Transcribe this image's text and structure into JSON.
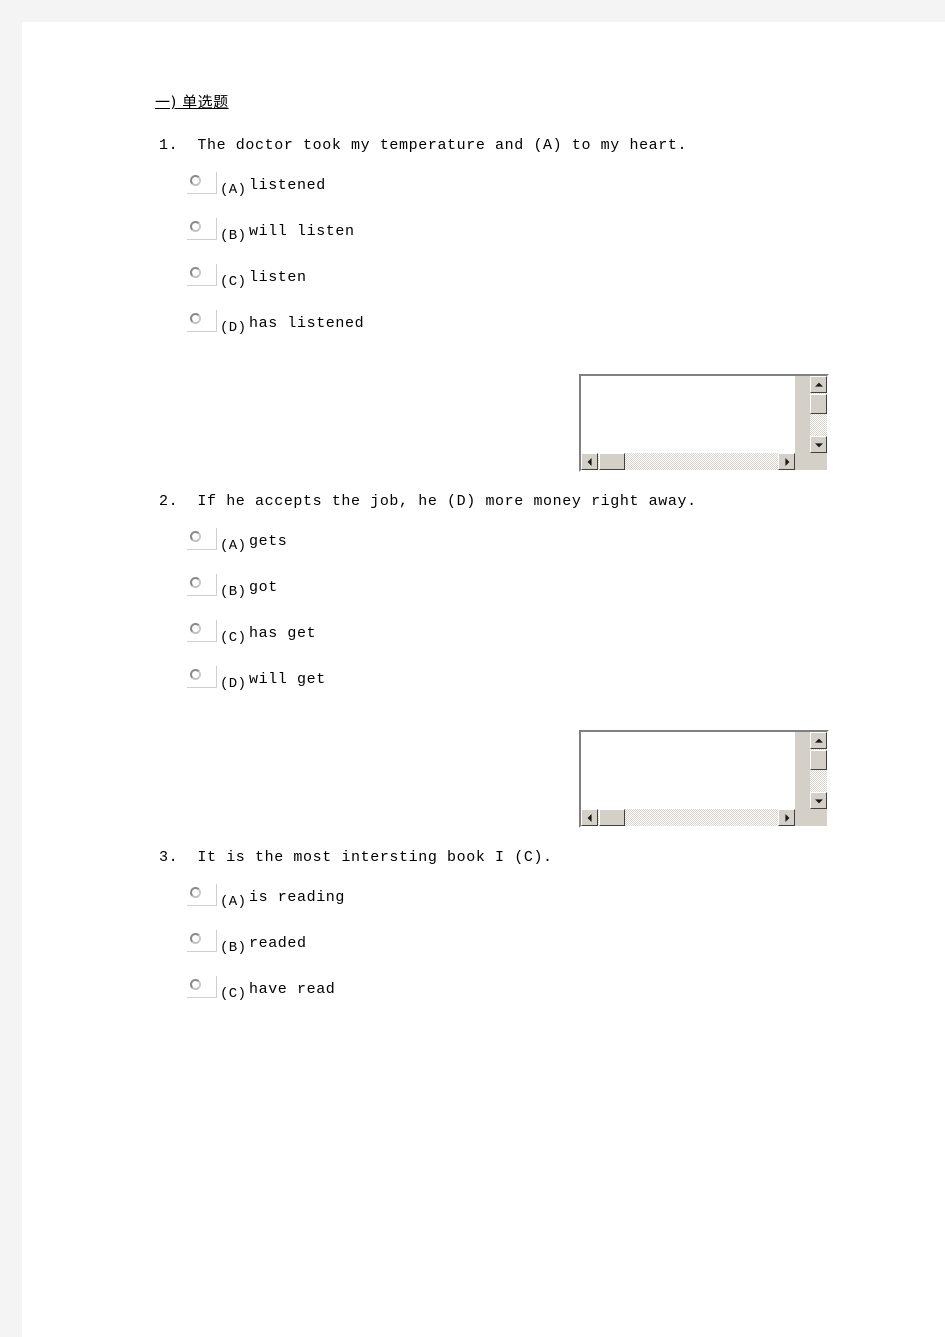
{
  "section": {
    "title": "一) 单选题"
  },
  "questions": [
    {
      "number": "1.",
      "text": "The doctor took my temperature and (A) to my heart.",
      "options": [
        {
          "letter": "(A)",
          "text": "listened"
        },
        {
          "letter": "(B)",
          "text": "will listen"
        },
        {
          "letter": "(C)",
          "text": "listen"
        },
        {
          "letter": "(D)",
          "text": "has listened"
        }
      ],
      "answer_box": {
        "value": "",
        "placeholder": ""
      }
    },
    {
      "number": "2.",
      "text": "If he accepts the job, he (D) more money right away.",
      "options": [
        {
          "letter": "(A)",
          "text": "gets"
        },
        {
          "letter": "(B)",
          "text": "got"
        },
        {
          "letter": "(C)",
          "text": "has get"
        },
        {
          "letter": "(D)",
          "text": "will get"
        }
      ],
      "answer_box": {
        "value": "",
        "placeholder": ""
      }
    },
    {
      "number": "3.",
      "text": "It is the most intersting book I (C).",
      "options": [
        {
          "letter": "(A)",
          "text": "is reading"
        },
        {
          "letter": "(B)",
          "text": "readed"
        },
        {
          "letter": "(C)",
          "text": "have read"
        }
      ],
      "answer_box": null
    }
  ],
  "colors": {
    "page_background": "#ffffff",
    "outer_frame": "#f4f4f4",
    "scrollbar_face": "#d4d0c8",
    "scrollbar_track": "#d8d4cc",
    "scrollbar_shadow": "#404040",
    "scrollbar_highlight": "#ffffff",
    "radio_ring": "#9a9a9a",
    "text": "#000000"
  },
  "icons": {
    "scroll_up": "triangle-up-icon",
    "scroll_down": "triangle-down-icon",
    "scroll_left": "triangle-left-icon",
    "scroll_right": "triangle-right-icon",
    "radio": "radio-unchecked-icon"
  }
}
